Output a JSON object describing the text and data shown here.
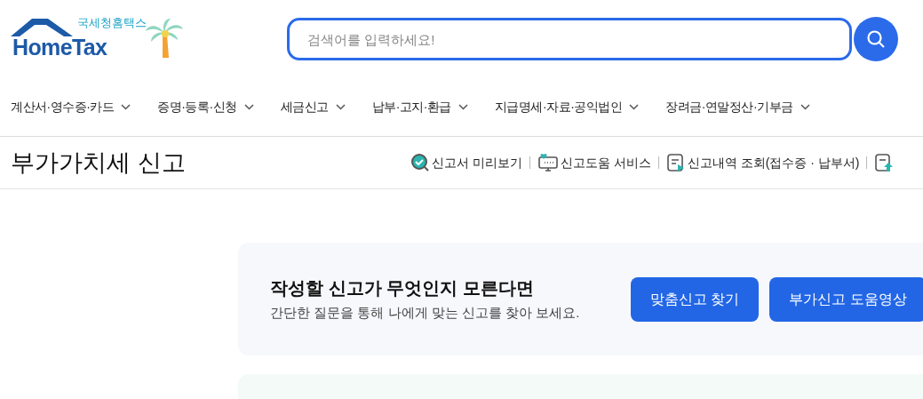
{
  "logo": {
    "subtitle": "국세청홈택스",
    "name": "HomeTax"
  },
  "search": {
    "placeholder": "검색어를 입력하세요!"
  },
  "nav": [
    {
      "label": "계산서·영수증·카드"
    },
    {
      "label": "증명·등록·신청"
    },
    {
      "label": "세금신고"
    },
    {
      "label": "납부·고지·환급"
    },
    {
      "label": "지급명세·자료·공익법인"
    },
    {
      "label": "장려금·연말정산·기부금"
    }
  ],
  "page_title": "부가가치세 신고",
  "tools": [
    {
      "kind": "preview",
      "label": "신고서 미리보기"
    },
    {
      "kind": "help",
      "label": "신고도움 서비스"
    },
    {
      "kind": "history",
      "label": "신고내역 조회(접수증 · 납부서)"
    },
    {
      "kind": "upload"
    }
  ],
  "guide": {
    "title": "작성할 신고가 무엇인지 모른다면",
    "description": "간단한 질문을 통해 나에게 맞는 신고를 찾아 보세요.",
    "buttons": [
      "맞춤신고 찾기",
      "부가신고 도움영상"
    ]
  }
}
